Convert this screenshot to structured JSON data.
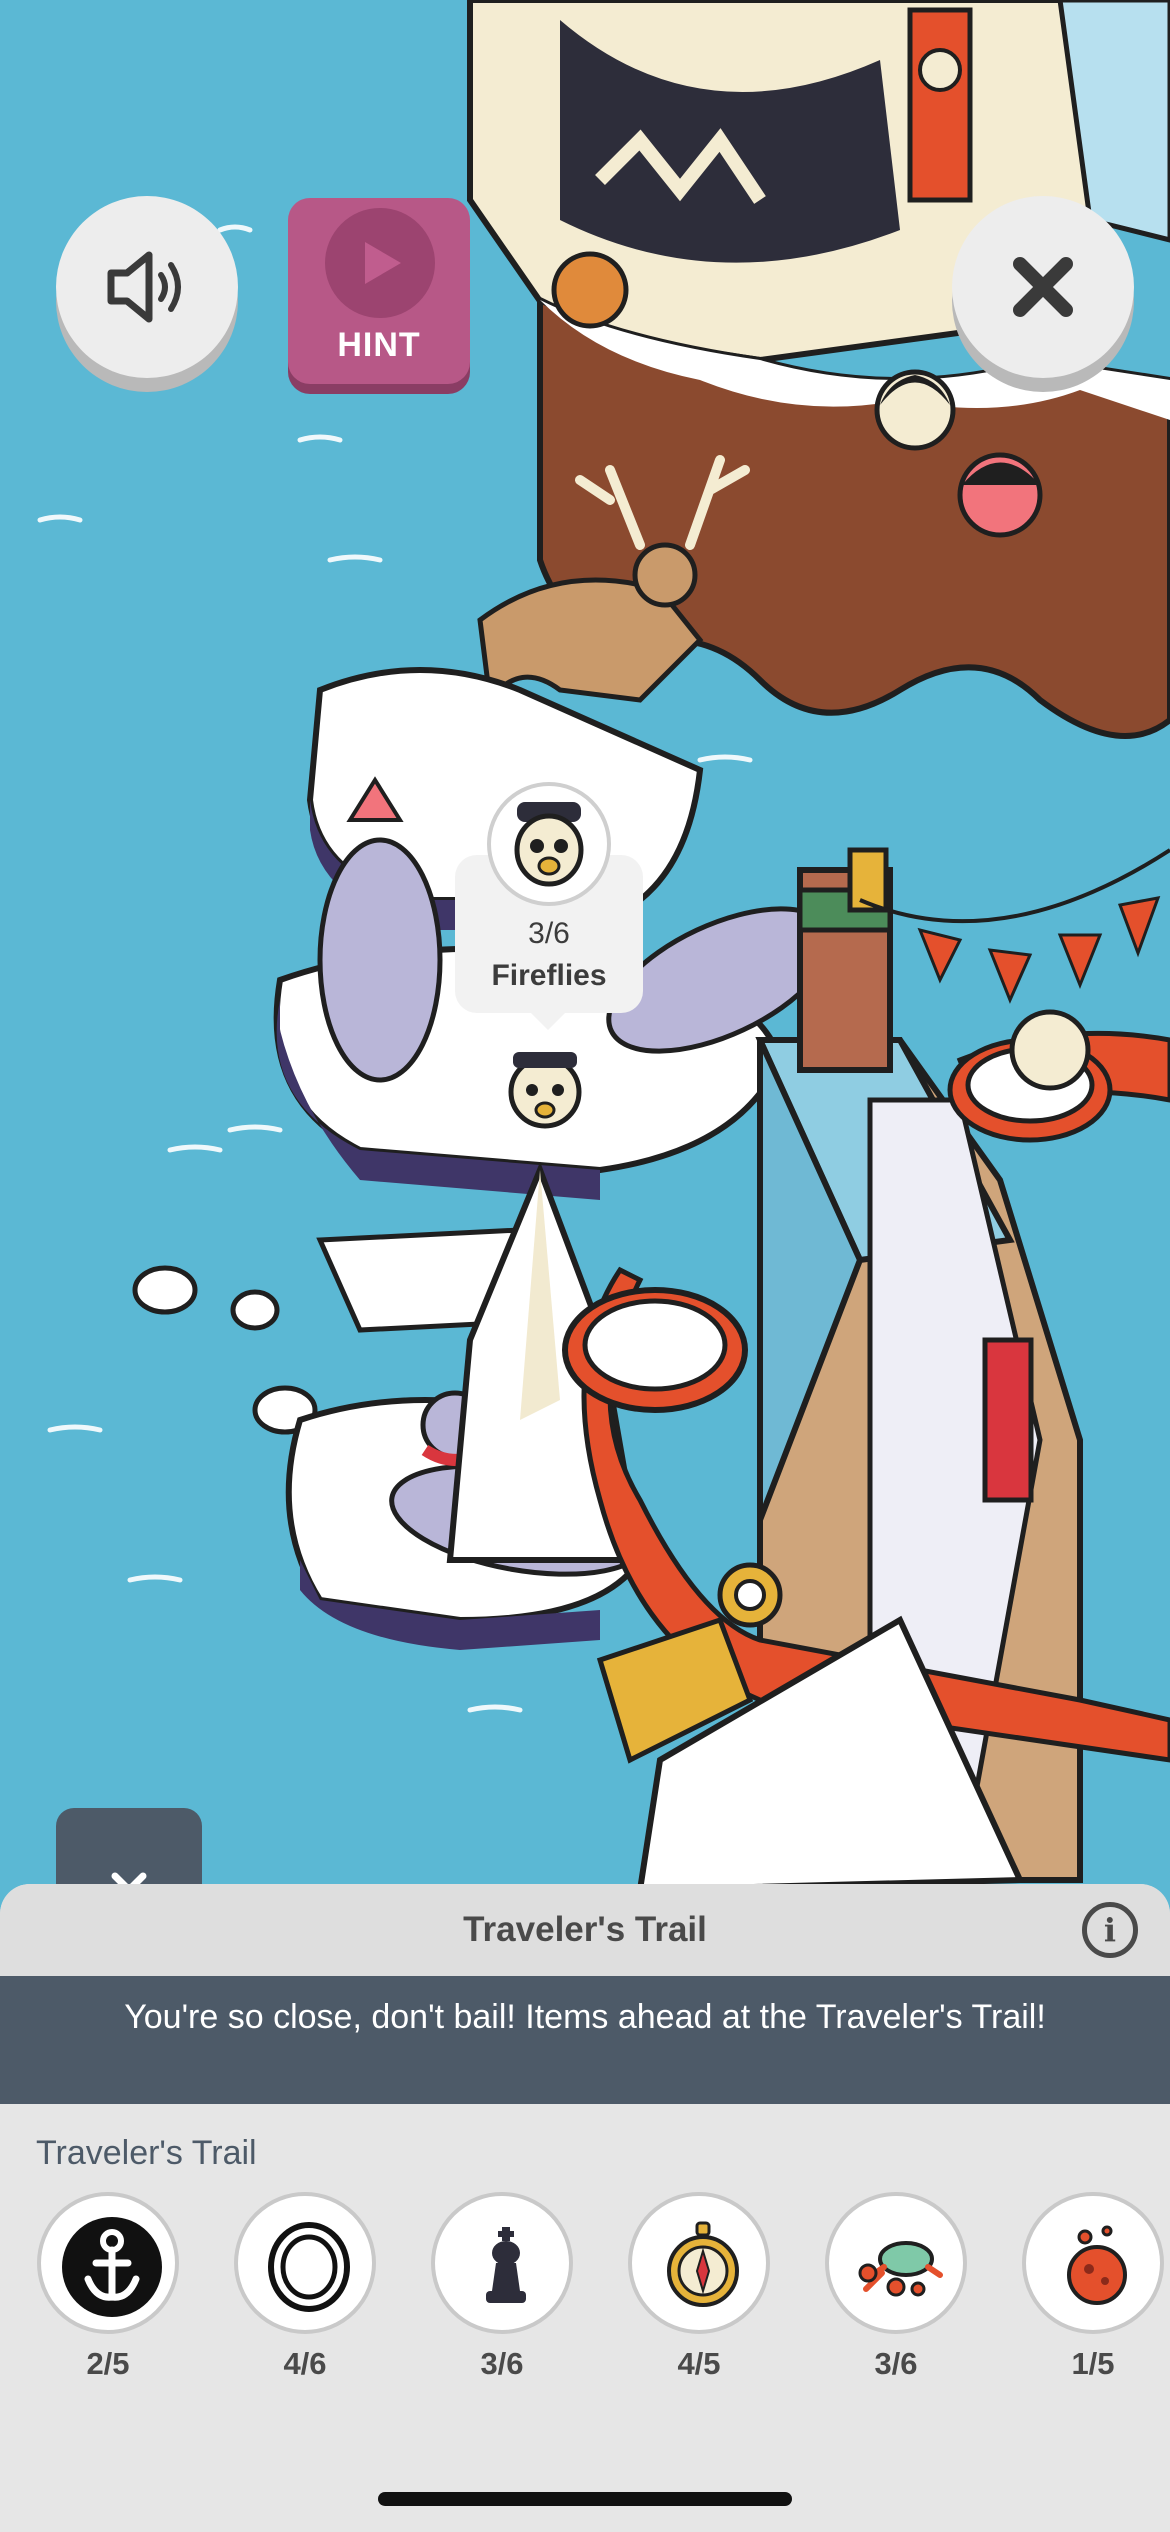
{
  "hint": {
    "label": "HINT"
  },
  "tooltip": {
    "count": "3/6",
    "label": "Fireflies"
  },
  "panel": {
    "title": "Traveler's Trail",
    "banner": "You're so close, don't bail! Items ahead at the Traveler's Trail!",
    "section_title": "Traveler's Trail",
    "items": [
      {
        "icon": "anchor-icon",
        "count": "2/5"
      },
      {
        "icon": "ring-icon",
        "count": "4/6"
      },
      {
        "icon": "chess-piece-icon",
        "count": "3/6"
      },
      {
        "icon": "compass-icon",
        "count": "4/5"
      },
      {
        "icon": "crab-icon",
        "count": "3/6"
      },
      {
        "icon": "red-orb-icon",
        "count": "1/5"
      }
    ]
  },
  "colors": {
    "water": "#5bb8d4",
    "hint_button": "#b75887",
    "banner": "#4d5a68",
    "panel": "#e6e6e6"
  }
}
